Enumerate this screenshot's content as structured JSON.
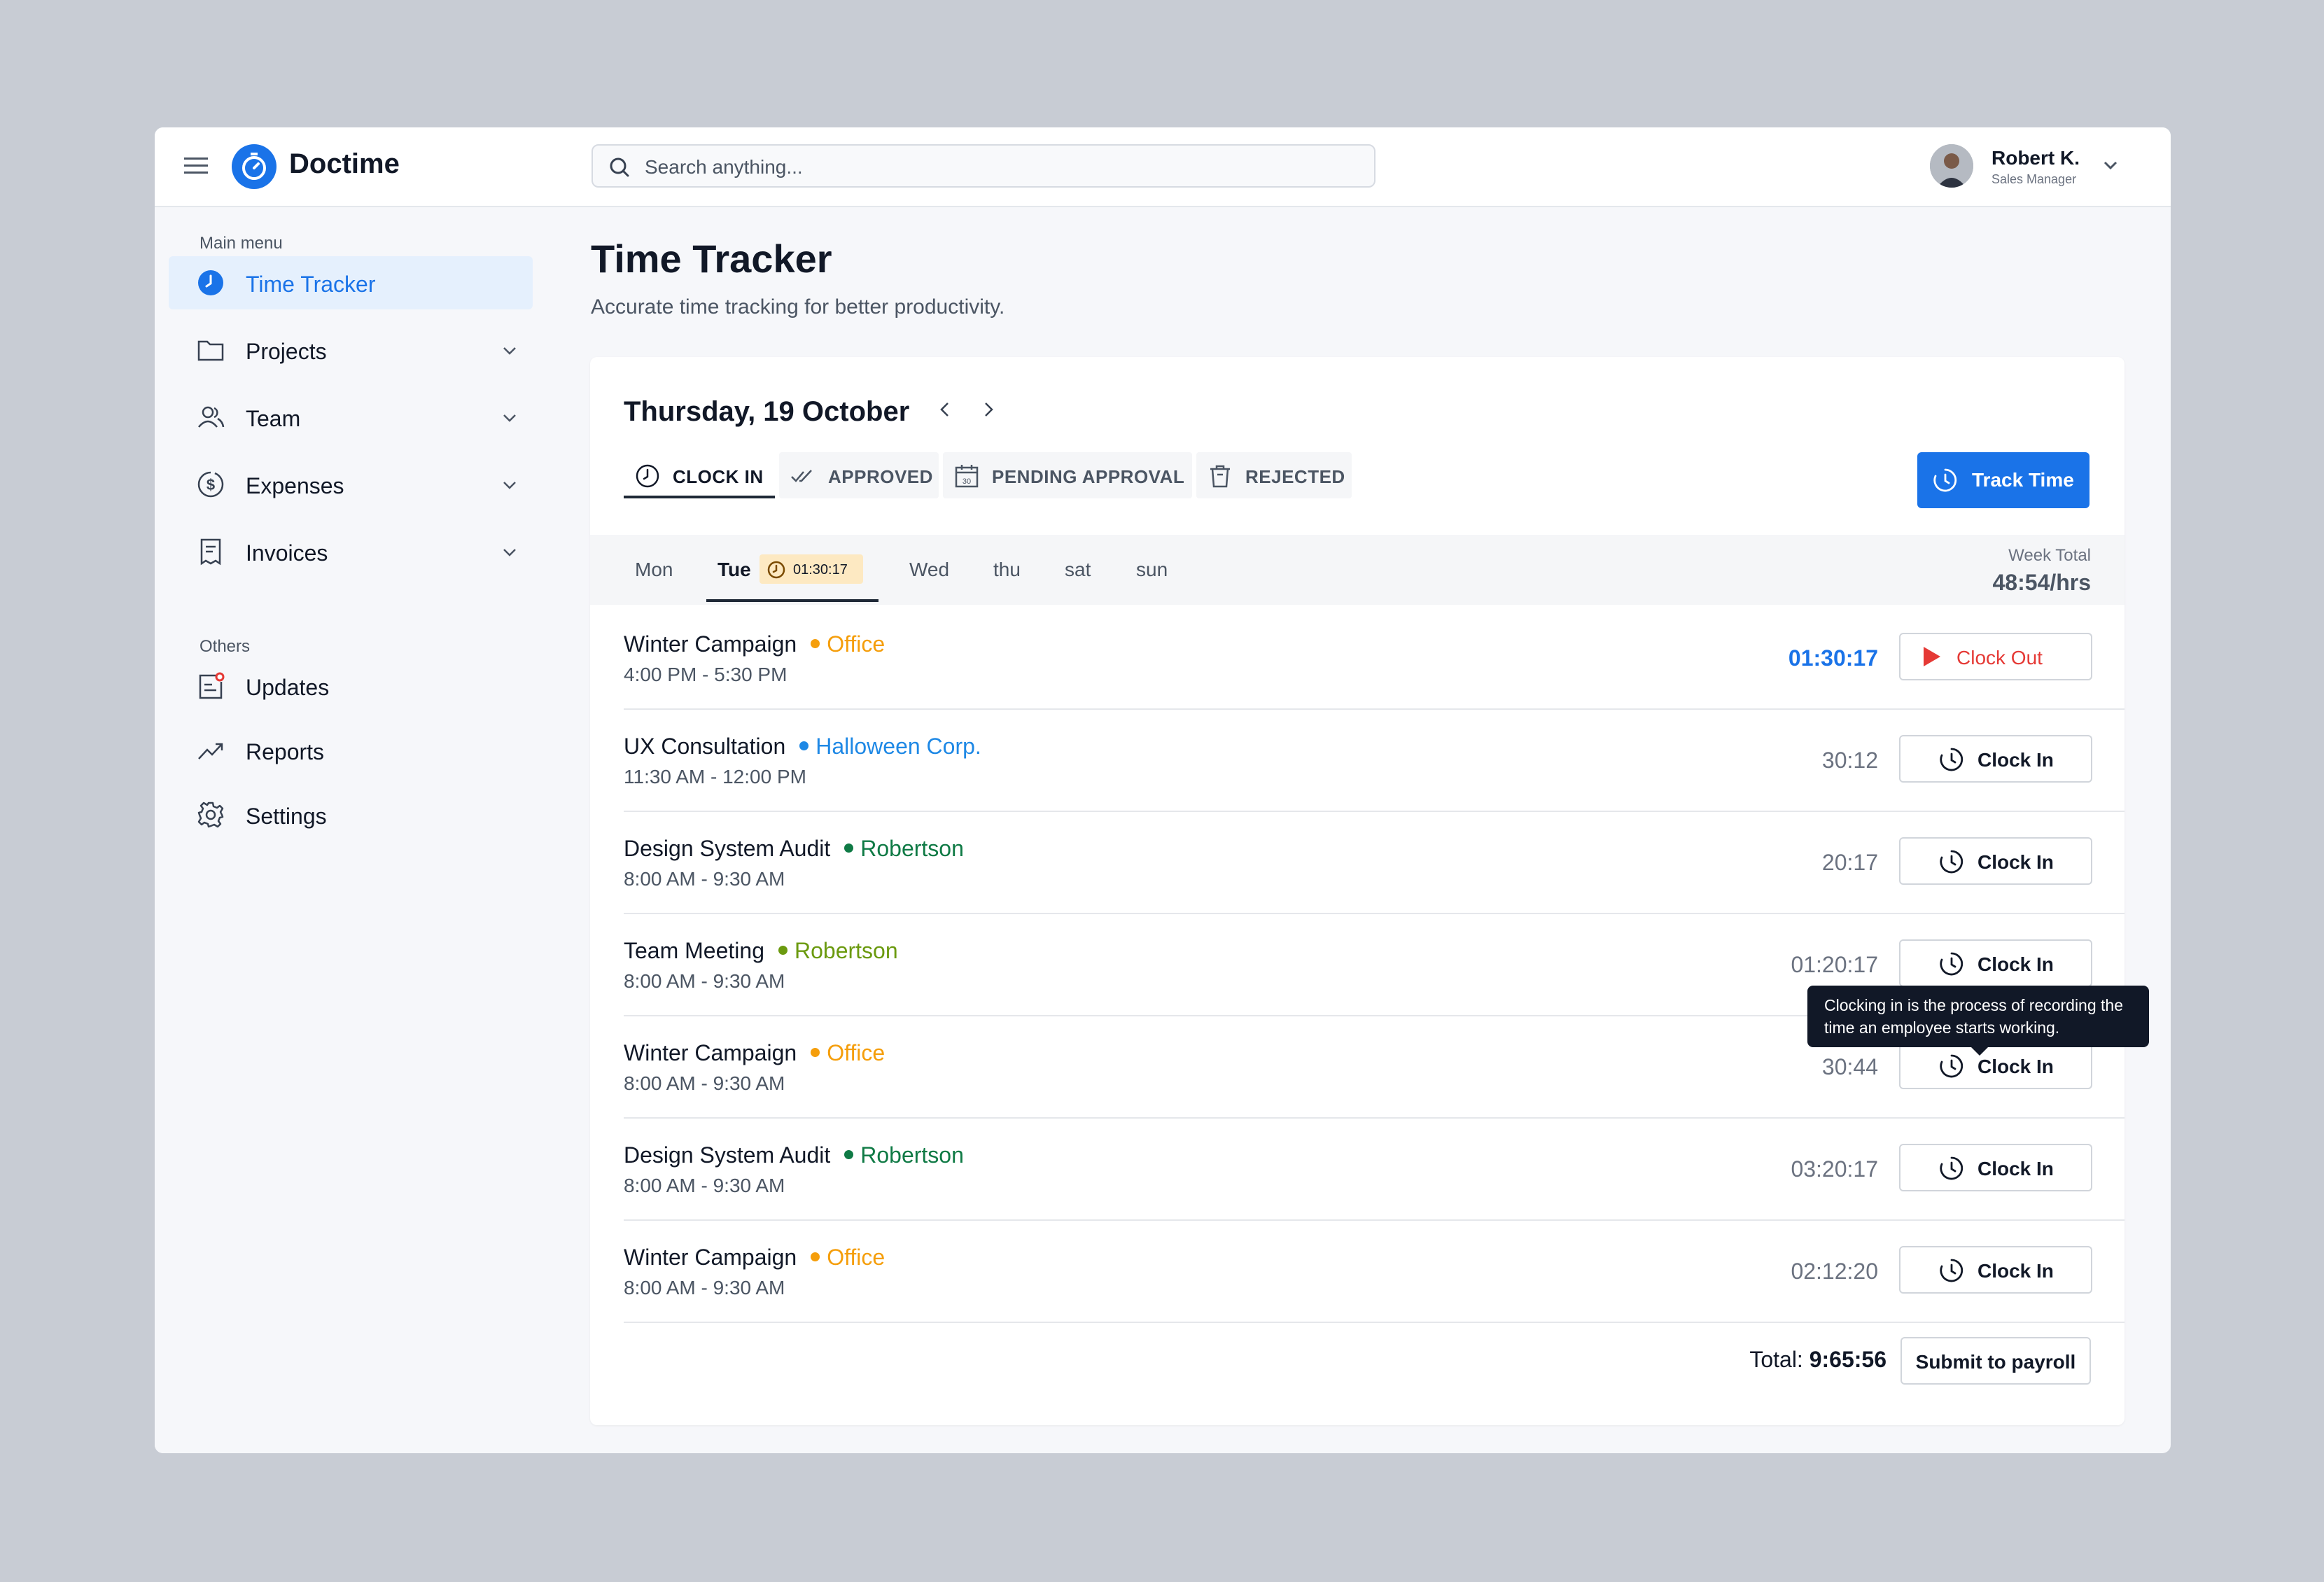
{
  "app": {
    "name": "Doctime"
  },
  "search": {
    "placeholder": "Search anything..."
  },
  "user": {
    "name": "Robert K.",
    "role": "Sales Manager"
  },
  "sidebar": {
    "main_label": "Main menu",
    "main_items": [
      {
        "label": "Time Tracker",
        "icon": "clock-icon",
        "active": true
      },
      {
        "label": "Projects",
        "icon": "folder-icon"
      },
      {
        "label": "Team",
        "icon": "team-icon"
      },
      {
        "label": "Expenses",
        "icon": "dollar-icon"
      },
      {
        "label": "Invoices",
        "icon": "invoice-icon"
      }
    ],
    "others_label": "Others",
    "other_items": [
      {
        "label": "Updates",
        "icon": "updates-icon"
      },
      {
        "label": "Reports",
        "icon": "trending-icon"
      },
      {
        "label": "Settings",
        "icon": "gear-icon"
      }
    ]
  },
  "page": {
    "title": "Time Tracker",
    "subtitle": "Accurate time tracking for better productivity."
  },
  "tracker": {
    "date": "Thursday, 19 October",
    "tabs": [
      {
        "label": "CLOCK IN",
        "icon": "clock-icon",
        "active": true
      },
      {
        "label": "APPROVED",
        "icon": "double-check-icon"
      },
      {
        "label": "PENDING APPROVAL",
        "icon": "calendar-icon"
      },
      {
        "label": "REJECTED",
        "icon": "trash-icon"
      }
    ],
    "track_button": "Track Time",
    "days": [
      "Mon",
      "Tue",
      "Wed",
      "thu",
      "sat",
      "sun"
    ],
    "active_day_timer": "01:30:17",
    "week_total_label": "Week Total",
    "week_total_value": "48:54/hrs",
    "entries": [
      {
        "project": "Winter Campaign",
        "client": "Office",
        "client_color": "#f59e0b",
        "time": "4:00 PM - 5:30 PM",
        "duration": "01:30:17",
        "action": "Clock Out",
        "live": true
      },
      {
        "project": "UX Consultation",
        "client": "Halloween Corp.",
        "client_color": "#1e88e5",
        "time": "11:30 AM - 12:00 PM",
        "duration": "30:12",
        "action": "Clock In"
      },
      {
        "project": "Design System Audit",
        "client": "Robertson",
        "client_color": "#0f7a45",
        "time": "8:00 AM - 9:30 AM",
        "duration": "20:17",
        "action": "Clock In"
      },
      {
        "project": "Team Meeting",
        "client": "Robertson",
        "client_color": "#6b9a0f",
        "time": "8:00 AM - 9:30 AM",
        "duration": "01:20:17",
        "action": "Clock In"
      },
      {
        "project": "Winter Campaign",
        "client": "Office",
        "client_color": "#f59e0b",
        "time": "8:00 AM - 9:30 AM",
        "duration": "30:44",
        "action": "Clock In"
      },
      {
        "project": "Design System Audit",
        "client": "Robertson",
        "client_color": "#0f7a45",
        "time": "8:00 AM - 9:30 AM",
        "duration": "03:20:17",
        "action": "Clock In"
      },
      {
        "project": "Winter Campaign",
        "client": "Office",
        "client_color": "#f59e0b",
        "time": "8:00 AM - 9:30 AM",
        "duration": "02:12:20",
        "action": "Clock In"
      }
    ],
    "tooltip": "Clocking in is the process of recording the time an employee starts working.",
    "total_label": "Total:",
    "total_value": "9:65:56",
    "submit_button": "Submit to payroll"
  },
  "colors": {
    "accent": "#1a73e8",
    "danger": "#e53935"
  }
}
